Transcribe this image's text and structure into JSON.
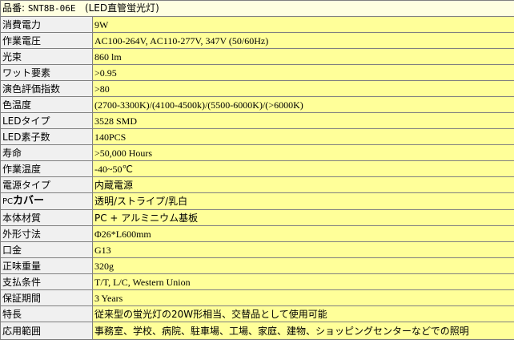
{
  "title": {
    "prefix": "品番:",
    "code": "SNT8B-06E",
    "subtitle": "(LED直管蛍光灯)"
  },
  "rows": [
    {
      "label": "消費電力",
      "value": "9W"
    },
    {
      "label": "作業電圧",
      "value": "AC100-264V, AC110-277V, 347V   (50/60Hz)"
    },
    {
      "label": "光束",
      "value": "860 lm"
    },
    {
      "label": "ワット要素",
      "value": ">0.95"
    },
    {
      "label": "演色評価指数",
      "value": ">80"
    },
    {
      "label": "色温度",
      "value": "(2700-3300K)/(4100-4500k)/(5500-6000K)/(>6000K)"
    },
    {
      "label": "LEDタイプ",
      "value": "3528 SMD"
    },
    {
      "label": "LED素子数",
      "value": "140PCS"
    },
    {
      "label": "寿命",
      "value": ">50,000 Hours"
    },
    {
      "label": "作業温度",
      "value": "-40~50℃"
    },
    {
      "label": "電源タイプ",
      "value": "内蔵電源"
    },
    {
      "label_prefix": "PC",
      "label": "カバー",
      "value": "透明/ストライプ/乳白"
    },
    {
      "label": "本体材質",
      "value": "PC + アルミニウム基板"
    },
    {
      "label": "外形寸法",
      "value": "Φ26*L600mm"
    },
    {
      "label": "口金",
      "value": "G13"
    },
    {
      "label": "正味重量",
      "value": "320g"
    },
    {
      "label": "支払条件",
      "value": "T/T, L/C, Western Union"
    },
    {
      "label": "保証期間",
      "value": "3 Years"
    },
    {
      "label": "特長",
      "value": "従来型の蛍光灯の20W形相当、交替品として使用可能"
    },
    {
      "label": "応用範囲",
      "value": "事務室、学校、病院、駐車場、工場、家庭、建物、ショッピングセンターなどでの照明"
    }
  ]
}
